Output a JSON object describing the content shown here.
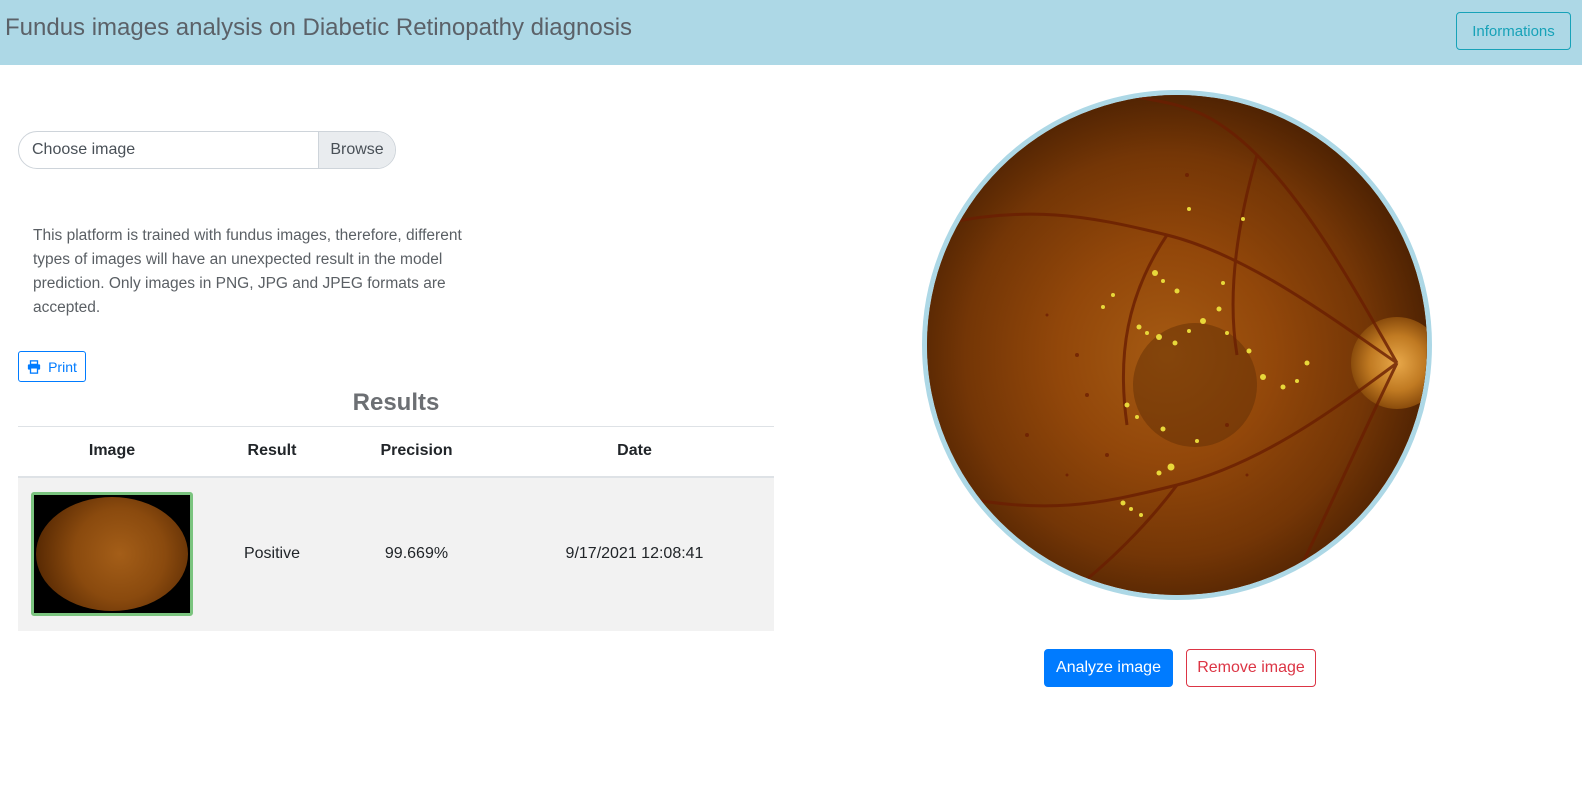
{
  "header": {
    "title": "Fundus images analysis on Diabetic Retinopathy diagnosis",
    "info_button": "Informations"
  },
  "upload": {
    "label": "Choose image",
    "browse": "Browse"
  },
  "notice": "This platform is trained with fundus images, therefore, different types of images will have an unexpected result in the model prediction. Only images in PNG, JPG and JPEG formats are accepted.",
  "print_button": "Print",
  "results": {
    "title": "Results",
    "columns": [
      "Image",
      "Result",
      "Precision",
      "Date"
    ],
    "rows": [
      {
        "result": "Positive",
        "precision": "99.669%",
        "date": "9/17/2021 12:08:41"
      }
    ]
  },
  "actions": {
    "analyze": "Analyze image",
    "remove": "Remove image"
  },
  "colors": {
    "navbar": "#add8e6",
    "info": "#17a2b8",
    "primary": "#007bff",
    "danger": "#dc3545",
    "thumb_border": "#7bc47f"
  },
  "icons": {
    "print": "printer-icon"
  }
}
